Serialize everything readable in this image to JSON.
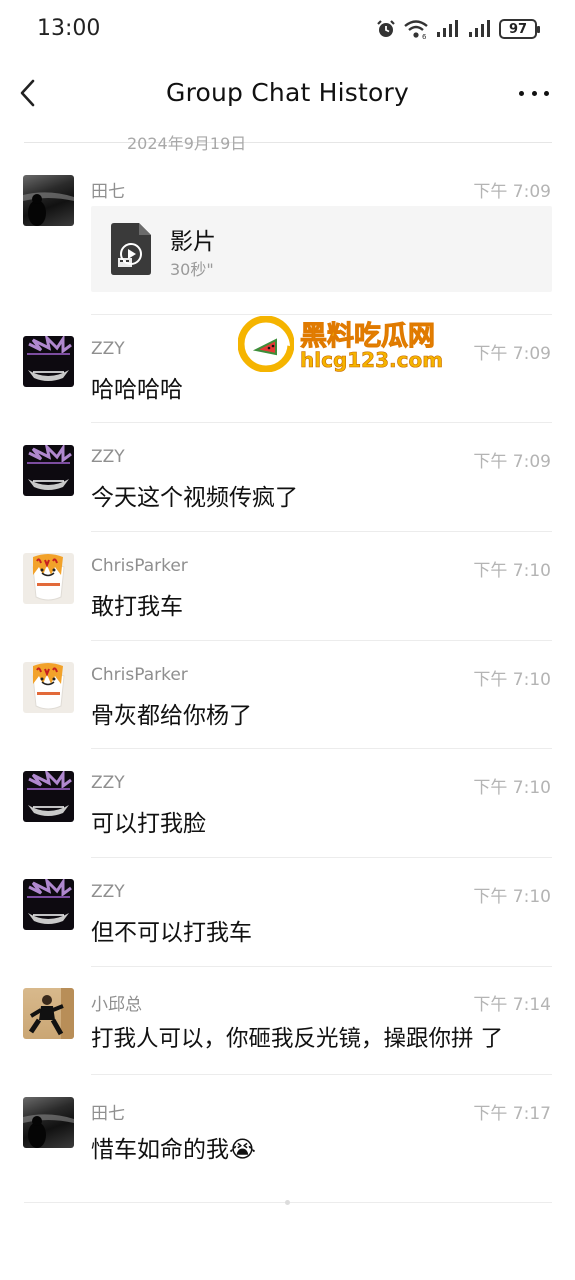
{
  "status_bar": {
    "time": "13:00",
    "battery": "97"
  },
  "nav": {
    "title": "Group Chat History"
  },
  "date_divider": "2024年9月19日",
  "file": {
    "name": "影片",
    "duration": "30秒\""
  },
  "messages": [
    {
      "sender": "田七",
      "time": "下午 7:09",
      "text": ""
    },
    {
      "sender": "ZZY",
      "time": "下午 7:09",
      "text": "哈哈哈哈"
    },
    {
      "sender": "ZZY",
      "time": "下午 7:09",
      "text": "今天这个视频传疯了"
    },
    {
      "sender": "ChrisParker",
      "time": "下午 7:10",
      "text": "敢打我车"
    },
    {
      "sender": "ChrisParker",
      "time": "下午 7:10",
      "text": "骨灰都给你杨了"
    },
    {
      "sender": "ZZY",
      "time": "下午 7:10",
      "text": "可以打我脸"
    },
    {
      "sender": "ZZY",
      "time": "下午 7:10",
      "text": "但不可以打我车"
    },
    {
      "sender": "小邱总",
      "time": "下午 7:14",
      "text": "打我人可以，你砸我反光镜，操跟你拼 了"
    },
    {
      "sender": "田七",
      "time": "下午 7:17",
      "text": "惜车如命的我😭"
    }
  ],
  "watermark": {
    "title": "黑料吃瓜网",
    "url": "hlcg123.com"
  }
}
